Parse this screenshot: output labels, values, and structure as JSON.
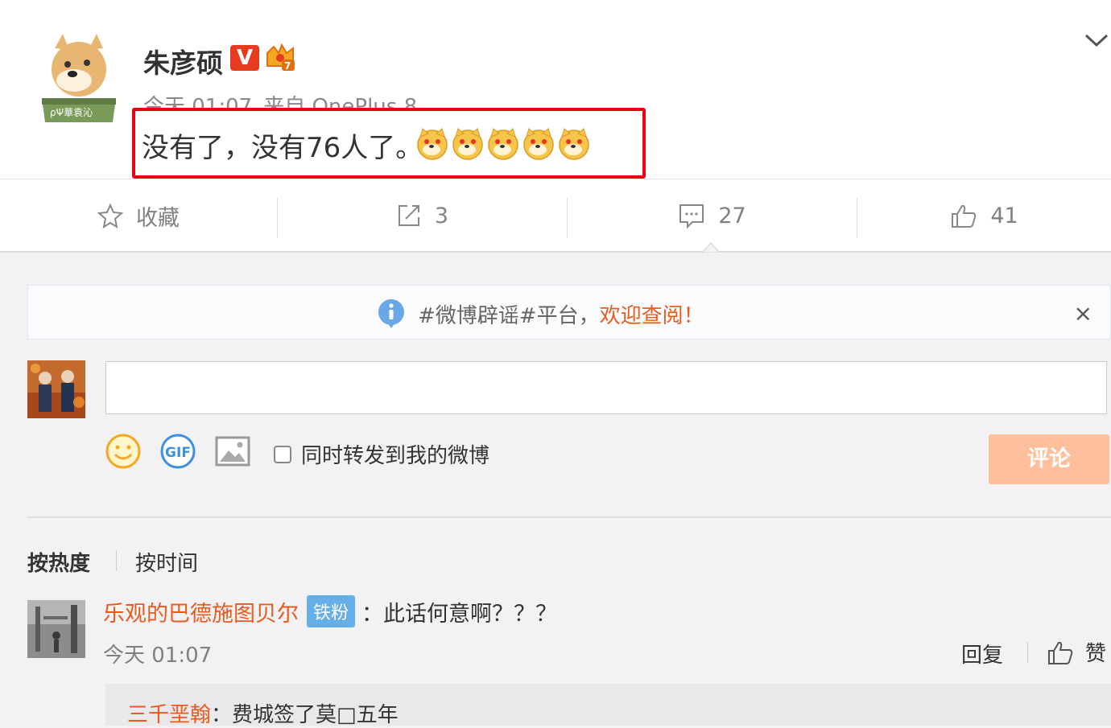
{
  "post": {
    "author": "朱彦硕",
    "verified_badge": "V",
    "time": "今天 01:07",
    "source": "来自 OnePlus 8",
    "text": "没有了，没有76人了。",
    "emoji_count": 5,
    "emoji_icon": "doge-emoji",
    "accent_color": "#e60012"
  },
  "actions": {
    "favorite_label": "收藏",
    "repost_count": "3",
    "comment_count": "27",
    "like_count": "41"
  },
  "notice": {
    "topic": "#微博辟谣#平台，",
    "welcome": "欢迎查阅！",
    "close": "×"
  },
  "composer": {
    "placeholder": "",
    "forward_label": "同时转发到我的微博",
    "submit_label": "评论",
    "gif_label": "GIF"
  },
  "sort": {
    "hot": "按热度",
    "time": "按时间"
  },
  "comments": [
    {
      "user": "乐观的巴德施图贝尔",
      "fan_badge": "铁粉",
      "text": "：此话何意啊？？？",
      "time": "今天 01:07",
      "reply_label": "回复",
      "like_label": "赞",
      "sub_reply": {
        "user": "三千垩翰",
        "text": "：费城签了莫□五年"
      }
    }
  ]
}
